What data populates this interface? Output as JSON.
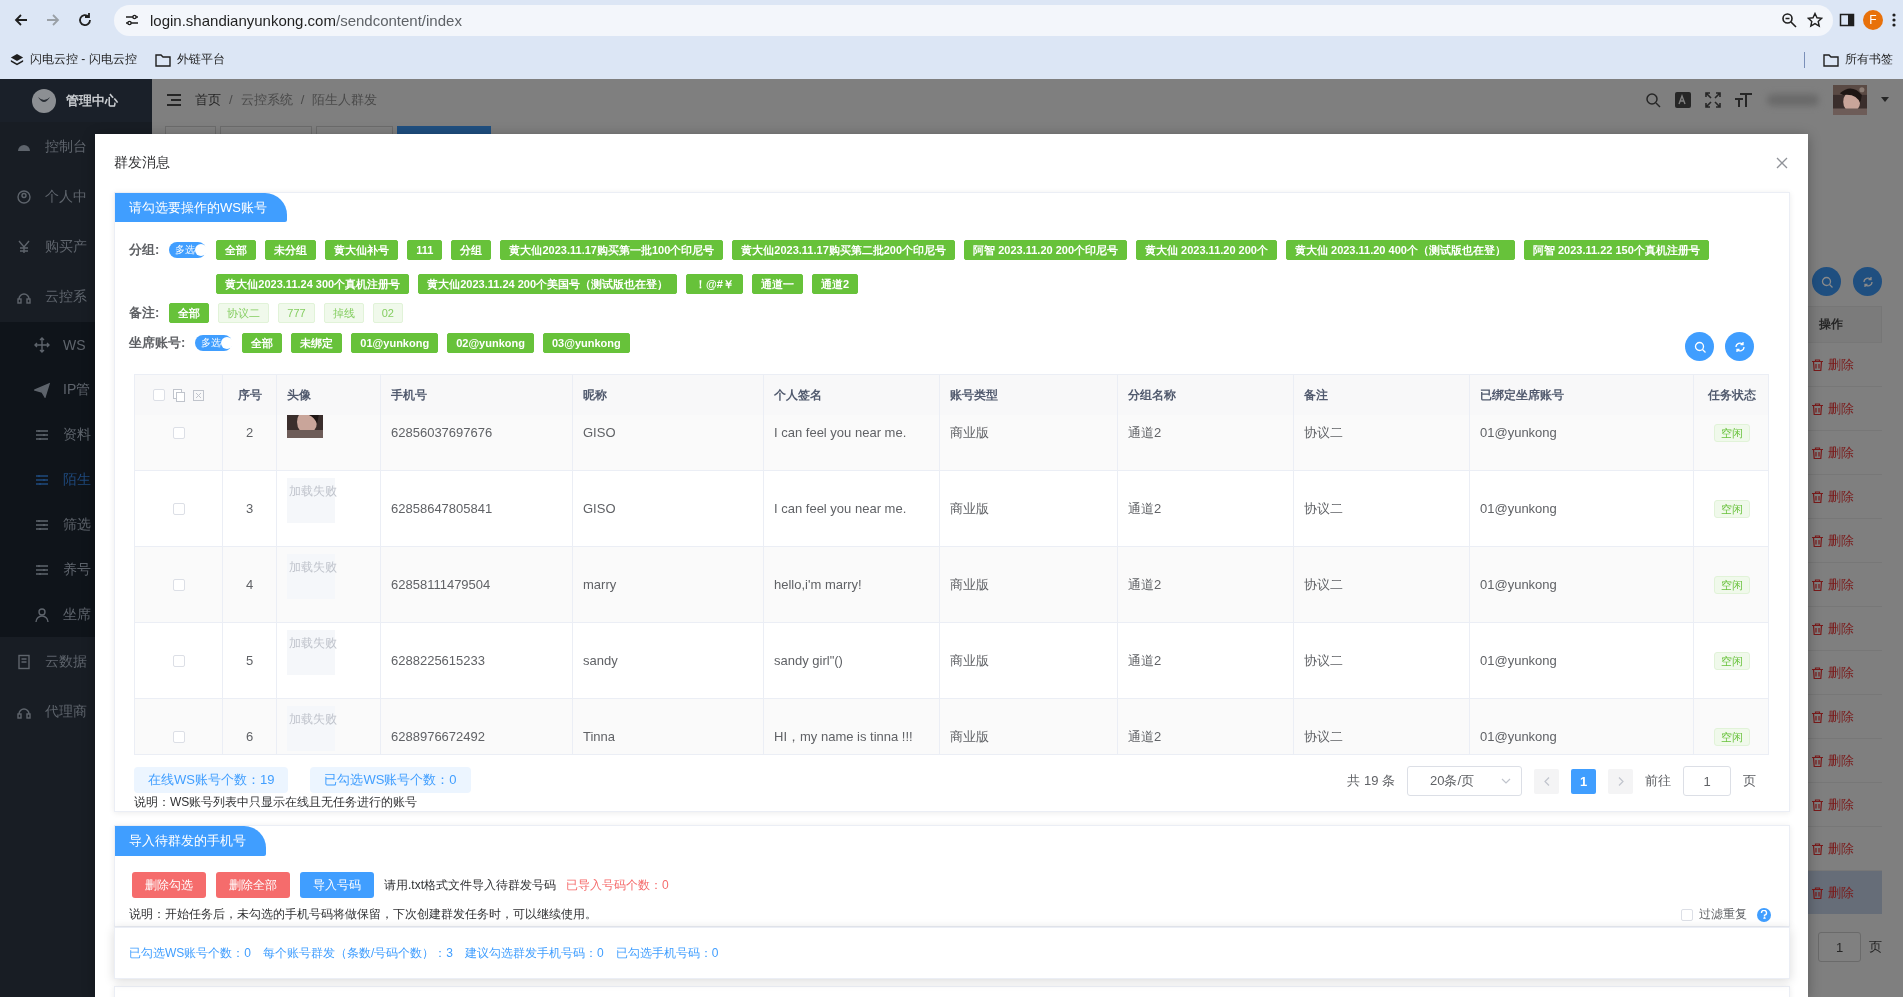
{
  "browser": {
    "url_host": "login.shandianyunkong.com",
    "url_path": "/sendcontent/index",
    "profile_initial": "F",
    "bookmarks": [
      {
        "label": "闪电云控 - 闪电云控",
        "kind": "stack"
      },
      {
        "label": "外链平台",
        "kind": "folder"
      }
    ],
    "all_bookmarks": "所有书签"
  },
  "app": {
    "brand": "管理中心",
    "sidebar": [
      {
        "label": "控制台",
        "kind": "gauge",
        "selected": false
      },
      {
        "label": "个人中",
        "kind": "badge",
        "selected": false
      },
      {
        "label": "购买产",
        "kind": "yen",
        "selected": false
      },
      {
        "label": "云控系",
        "kind": "headset",
        "selected": false,
        "expanded": true,
        "children": [
          {
            "label": "WS",
            "kind": "move",
            "selected": false
          },
          {
            "label": "IP管",
            "kind": "send",
            "selected": false
          },
          {
            "label": "资料",
            "kind": "sliders",
            "selected": false
          },
          {
            "label": "陌生",
            "kind": "sliders",
            "selected": true
          },
          {
            "label": "筛选",
            "kind": "sliders",
            "selected": false
          },
          {
            "label": "养号",
            "kind": "sliders",
            "selected": false
          },
          {
            "label": "坐席",
            "kind": "person",
            "selected": false
          }
        ]
      },
      {
        "label": "云数据",
        "kind": "book",
        "selected": false
      },
      {
        "label": "代理商",
        "kind": "headset",
        "selected": false
      }
    ],
    "breadcrumb": [
      "首页",
      "云控系统",
      "陌生人群发"
    ],
    "breadcrumb_separator": "/",
    "page_tabs": [
      {
        "selected": false
      },
      {
        "selected": false
      },
      {
        "selected": false
      },
      {
        "selected": true
      }
    ],
    "background_table": {
      "header": "操作",
      "rows": [
        {
          "label": "删除",
          "hovered": false
        },
        {
          "label": "删除",
          "hovered": false
        },
        {
          "label": "删除",
          "hovered": false
        },
        {
          "label": "删除",
          "hovered": false
        },
        {
          "label": "删除",
          "hovered": false
        },
        {
          "label": "删除",
          "hovered": false
        },
        {
          "label": "删除",
          "hovered": false
        },
        {
          "label": "删除",
          "hovered": false
        },
        {
          "label": "删除",
          "hovered": false
        },
        {
          "label": "删除",
          "hovered": false
        },
        {
          "label": "删除",
          "hovered": false
        },
        {
          "label": "删除",
          "hovered": false
        },
        {
          "label": "删除",
          "hovered": true
        }
      ],
      "goto_value": "1",
      "page_unit": "页"
    }
  },
  "dialog": {
    "title": "群发消息",
    "accounts": {
      "heading": "请勾选要操作的WS账号",
      "filters": [
        {
          "label": "分组:",
          "multi_select": {
            "label": "多选",
            "on": true
          },
          "tags": [
            {
              "label": "全部",
              "selected": true
            },
            {
              "label": "未分组",
              "selected": true
            },
            {
              "label": "黄大仙补号",
              "selected": true
            },
            {
              "label": "111",
              "selected": true
            },
            {
              "label": "分组",
              "selected": true
            },
            {
              "label": "黄大仙2023.11.17购买第一批100个印尼号",
              "selected": true
            },
            {
              "label": "黄大仙2023.11.17购买第二批200个印尼号",
              "selected": true
            },
            {
              "label": "阿智 2023.11.20 200个印尼号",
              "selected": true
            },
            {
              "label": "黄大仙 2023.11.20 200个",
              "selected": true
            },
            {
              "label": "黄大仙 2023.11.20 400个（测试版也在登）",
              "selected": true
            },
            {
              "label": "阿智 2023.11.22 150个真机注册号",
              "selected": true
            },
            {
              "label": "黄大仙2023.11.24 300个真机注册号",
              "selected": true
            },
            {
              "label": "黄大仙2023.11.24 200个美国号（测试版也在登）",
              "selected": true
            },
            {
              "label": "！@#￥",
              "selected": true
            },
            {
              "label": "通道一",
              "selected": true
            },
            {
              "label": "通道2",
              "selected": true
            }
          ]
        },
        {
          "label": "备注:",
          "tags": [
            {
              "label": "全部",
              "selected": true
            },
            {
              "label": "协议二",
              "selected": false
            },
            {
              "label": "777",
              "selected": false
            },
            {
              "label": "掉线",
              "selected": false
            },
            {
              "label": "02",
              "selected": false
            }
          ]
        },
        {
          "label": "坐席账号:",
          "multi_select": {
            "label": "多选",
            "on": true
          },
          "tags": [
            {
              "label": "全部",
              "selected": true
            },
            {
              "label": "未绑定",
              "selected": true
            },
            {
              "label": "01@yunkong",
              "selected": true
            },
            {
              "label": "02@yunkong",
              "selected": true
            },
            {
              "label": "03@yunkong",
              "selected": true
            }
          ]
        }
      ],
      "table": {
        "header_checked": false,
        "columns": [
          "序号",
          "头像",
          "手机号",
          "昵称",
          "个人签名",
          "账号类型",
          "分组名称",
          "备注",
          "已绑定坐席账号",
          "任务状态"
        ],
        "rows": [
          {
            "checked": false,
            "no": "2",
            "phone": "62856037697676",
            "nickname": "GISO",
            "signature": "I can feel you near me.",
            "account_type": "商业版",
            "group": "通道2",
            "remark": "协议二",
            "seat": "01@yunkong",
            "status": "空闲"
          },
          {
            "checked": false,
            "no": "3",
            "avatar": {
              "kind": "failed",
              "text": "加载失败"
            },
            "phone": "62858647805841",
            "nickname": "GISO",
            "signature": "I can feel you near me.",
            "account_type": "商业版",
            "group": "通道2",
            "remark": "协议二",
            "seat": "01@yunkong",
            "status": "空闲"
          },
          {
            "checked": false,
            "no": "4",
            "avatar": {
              "kind": "failed",
              "text": "加载失败"
            },
            "phone": "62858111479504",
            "nickname": "marry",
            "signature": "hello,i'm marry!",
            "account_type": "商业版",
            "group": "通道2",
            "remark": "协议二",
            "seat": "01@yunkong",
            "status": "空闲"
          },
          {
            "checked": false,
            "no": "5",
            "avatar": {
              "kind": "failed",
              "text": "加载失败"
            },
            "phone": "6288225615233",
            "nickname": "sandy",
            "signature": "sandy girl\"()",
            "account_type": "商业版",
            "group": "通道2",
            "remark": "协议二",
            "seat": "01@yunkong",
            "status": "空闲"
          },
          {
            "checked": false,
            "no": "6",
            "avatar": {
              "kind": "failed",
              "text": "加载失败"
            },
            "phone": "6288976672492",
            "nickname": "Tinna",
            "signature": "HI，my name is tinna !!!",
            "account_type": "商业版",
            "group": "通道2",
            "remark": "协议二",
            "seat": "01@yunkong",
            "status": "空闲"
          }
        ]
      },
      "online_count": "在线WS账号个数：19",
      "checked_count": "已勾选WS账号个数：0",
      "note": "说明：WS账号列表中只显示在线且无任务进行的账号",
      "pagination": {
        "total": "共 19 条",
        "page_size": "20条/页",
        "pages": [
          {
            "label": "1",
            "selected": true
          }
        ],
        "goto_label": "前往",
        "goto_value": "1",
        "page_unit": "页"
      }
    },
    "import": {
      "heading": "导入待群发的手机号",
      "buttons": [
        {
          "label": "删除勾选",
          "kind": "danger"
        },
        {
          "label": "删除全部",
          "kind": "danger"
        },
        {
          "label": "导入号码",
          "kind": "primary"
        }
      ],
      "hint": "请用.txt格式文件导入待群发号码",
      "imported_count": "已导入号码个数：0",
      "note": "说明：开始任务后，未勾选的手机号码将做保留，下次创建群发任务时，可以继续使用。",
      "filter_duplicates": {
        "label": "过滤重复",
        "checked": false
      }
    },
    "summary": [
      "已勾选WS账号个数：0",
      "每个账号群发（条数/号码个数）：3",
      "建议勾选群发手机号码：0",
      "已勾选手机号码：0"
    ]
  }
}
